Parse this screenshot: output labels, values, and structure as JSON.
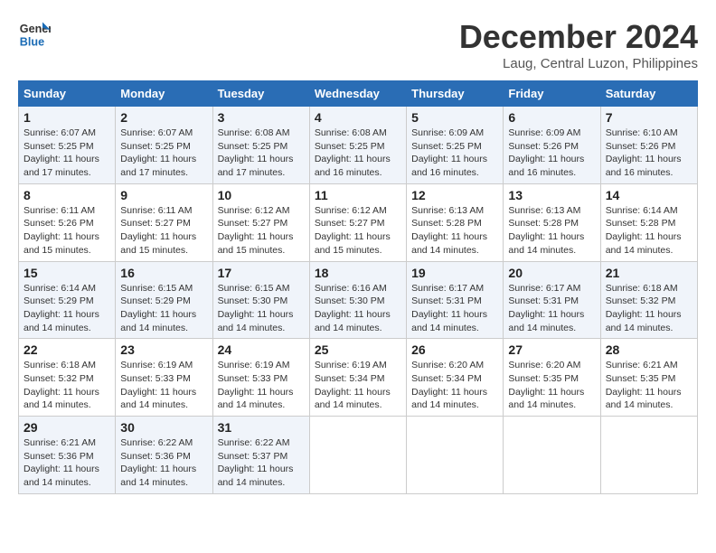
{
  "header": {
    "logo_line1": "General",
    "logo_line2": "Blue",
    "month_title": "December 2024",
    "location": "Laug, Central Luzon, Philippines"
  },
  "weekdays": [
    "Sunday",
    "Monday",
    "Tuesday",
    "Wednesday",
    "Thursday",
    "Friday",
    "Saturday"
  ],
  "weeks": [
    [
      {
        "day": "1",
        "sunrise": "6:07 AM",
        "sunset": "5:25 PM",
        "daylight": "11 hours and 17 minutes."
      },
      {
        "day": "2",
        "sunrise": "6:07 AM",
        "sunset": "5:25 PM",
        "daylight": "11 hours and 17 minutes."
      },
      {
        "day": "3",
        "sunrise": "6:08 AM",
        "sunset": "5:25 PM",
        "daylight": "11 hours and 17 minutes."
      },
      {
        "day": "4",
        "sunrise": "6:08 AM",
        "sunset": "5:25 PM",
        "daylight": "11 hours and 16 minutes."
      },
      {
        "day": "5",
        "sunrise": "6:09 AM",
        "sunset": "5:25 PM",
        "daylight": "11 hours and 16 minutes."
      },
      {
        "day": "6",
        "sunrise": "6:09 AM",
        "sunset": "5:26 PM",
        "daylight": "11 hours and 16 minutes."
      },
      {
        "day": "7",
        "sunrise": "6:10 AM",
        "sunset": "5:26 PM",
        "daylight": "11 hours and 16 minutes."
      }
    ],
    [
      {
        "day": "8",
        "sunrise": "6:11 AM",
        "sunset": "5:26 PM",
        "daylight": "11 hours and 15 minutes."
      },
      {
        "day": "9",
        "sunrise": "6:11 AM",
        "sunset": "5:27 PM",
        "daylight": "11 hours and 15 minutes."
      },
      {
        "day": "10",
        "sunrise": "6:12 AM",
        "sunset": "5:27 PM",
        "daylight": "11 hours and 15 minutes."
      },
      {
        "day": "11",
        "sunrise": "6:12 AM",
        "sunset": "5:27 PM",
        "daylight": "11 hours and 15 minutes."
      },
      {
        "day": "12",
        "sunrise": "6:13 AM",
        "sunset": "5:28 PM",
        "daylight": "11 hours and 14 minutes."
      },
      {
        "day": "13",
        "sunrise": "6:13 AM",
        "sunset": "5:28 PM",
        "daylight": "11 hours and 14 minutes."
      },
      {
        "day": "14",
        "sunrise": "6:14 AM",
        "sunset": "5:28 PM",
        "daylight": "11 hours and 14 minutes."
      }
    ],
    [
      {
        "day": "15",
        "sunrise": "6:14 AM",
        "sunset": "5:29 PM",
        "daylight": "11 hours and 14 minutes."
      },
      {
        "day": "16",
        "sunrise": "6:15 AM",
        "sunset": "5:29 PM",
        "daylight": "11 hours and 14 minutes."
      },
      {
        "day": "17",
        "sunrise": "6:15 AM",
        "sunset": "5:30 PM",
        "daylight": "11 hours and 14 minutes."
      },
      {
        "day": "18",
        "sunrise": "6:16 AM",
        "sunset": "5:30 PM",
        "daylight": "11 hours and 14 minutes."
      },
      {
        "day": "19",
        "sunrise": "6:17 AM",
        "sunset": "5:31 PM",
        "daylight": "11 hours and 14 minutes."
      },
      {
        "day": "20",
        "sunrise": "6:17 AM",
        "sunset": "5:31 PM",
        "daylight": "11 hours and 14 minutes."
      },
      {
        "day": "21",
        "sunrise": "6:18 AM",
        "sunset": "5:32 PM",
        "daylight": "11 hours and 14 minutes."
      }
    ],
    [
      {
        "day": "22",
        "sunrise": "6:18 AM",
        "sunset": "5:32 PM",
        "daylight": "11 hours and 14 minutes."
      },
      {
        "day": "23",
        "sunrise": "6:19 AM",
        "sunset": "5:33 PM",
        "daylight": "11 hours and 14 minutes."
      },
      {
        "day": "24",
        "sunrise": "6:19 AM",
        "sunset": "5:33 PM",
        "daylight": "11 hours and 14 minutes."
      },
      {
        "day": "25",
        "sunrise": "6:19 AM",
        "sunset": "5:34 PM",
        "daylight": "11 hours and 14 minutes."
      },
      {
        "day": "26",
        "sunrise": "6:20 AM",
        "sunset": "5:34 PM",
        "daylight": "11 hours and 14 minutes."
      },
      {
        "day": "27",
        "sunrise": "6:20 AM",
        "sunset": "5:35 PM",
        "daylight": "11 hours and 14 minutes."
      },
      {
        "day": "28",
        "sunrise": "6:21 AM",
        "sunset": "5:35 PM",
        "daylight": "11 hours and 14 minutes."
      }
    ],
    [
      {
        "day": "29",
        "sunrise": "6:21 AM",
        "sunset": "5:36 PM",
        "daylight": "11 hours and 14 minutes."
      },
      {
        "day": "30",
        "sunrise": "6:22 AM",
        "sunset": "5:36 PM",
        "daylight": "11 hours and 14 minutes."
      },
      {
        "day": "31",
        "sunrise": "6:22 AM",
        "sunset": "5:37 PM",
        "daylight": "11 hours and 14 minutes."
      },
      null,
      null,
      null,
      null
    ]
  ]
}
